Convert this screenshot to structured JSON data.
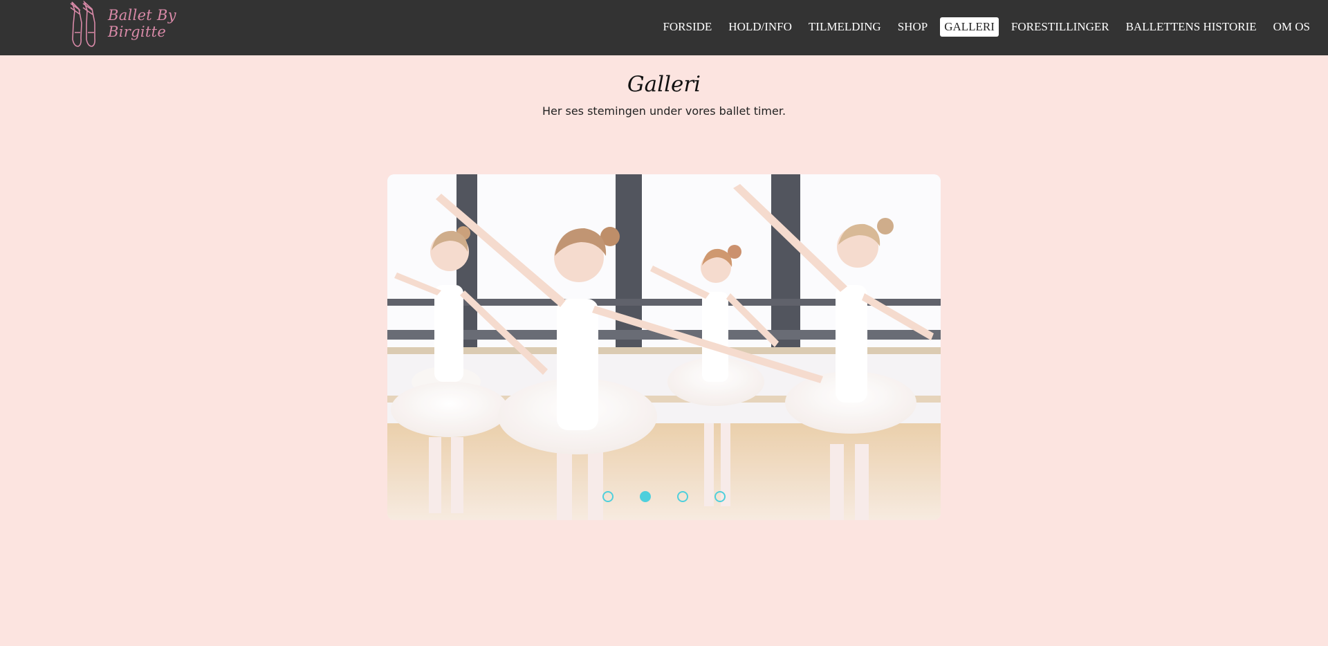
{
  "brand": {
    "name": "Ballet By Birgitte",
    "logo_icon": "ballet-shoes-icon",
    "logo_color": "#d98aa8"
  },
  "nav": {
    "items": [
      {
        "label": "FORSIDE"
      },
      {
        "label": "HOLD/INFO"
      },
      {
        "label": "TILMELDING"
      },
      {
        "label": "SHOP"
      },
      {
        "label": "GALLERI",
        "active": true
      },
      {
        "label": "FORESTILLINGER"
      },
      {
        "label": "BALLETTENS HISTORIE"
      },
      {
        "label": "OM OS"
      }
    ]
  },
  "page": {
    "title": "Galleri",
    "subtitle": "Her ses stemingen under vores ballet timer."
  },
  "carousel": {
    "image_subject": "young-ballet-dancers-in-white-tutus",
    "slide_count": 4,
    "active_index": 1,
    "dot_color": "#4fcfdc"
  },
  "colors": {
    "header_bg": "#333333",
    "page_bg": "#fce4e0"
  }
}
